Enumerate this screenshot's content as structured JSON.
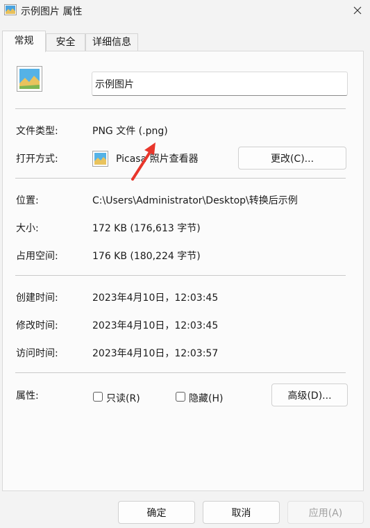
{
  "window": {
    "title": "示例图片 属性",
    "close_icon": "close-icon"
  },
  "tabs": [
    {
      "label": "常规",
      "active": true
    },
    {
      "label": "安全",
      "active": false
    },
    {
      "label": "详细信息",
      "active": false
    }
  ],
  "file": {
    "name": "示例图片",
    "icon": "image-file-icon"
  },
  "props": {
    "type_label": "文件类型:",
    "type_value": "PNG 文件 (.png)",
    "open_label": "打开方式:",
    "open_value": "Picasa 照片查看器",
    "open_icon": "picasa-icon",
    "change_button": "更改(C)...",
    "location_label": "位置:",
    "location_value": "C:\\Users\\Administrator\\Desktop\\转换后示例",
    "size_label": "大小:",
    "size_value": "172 KB (176,613 字节)",
    "disk_label": "占用空间:",
    "disk_value": "176 KB (180,224 字节)",
    "created_label": "创建时间:",
    "created_value": "2023年4月10日，12:03:45",
    "modified_label": "修改时间:",
    "modified_value": "2023年4月10日，12:03:45",
    "accessed_label": "访问时间:",
    "accessed_value": "2023年4月10日，12:03:57",
    "attr_label": "属性:",
    "readonly_label": "只读(R)",
    "readonly_checked": false,
    "hidden_label": "隐藏(H)",
    "hidden_checked": false,
    "advanced_button": "高级(D)..."
  },
  "footer": {
    "ok": "确定",
    "cancel": "取消",
    "apply": "应用(A)"
  },
  "colors": {
    "annotation_arrow": "#e8362b"
  }
}
